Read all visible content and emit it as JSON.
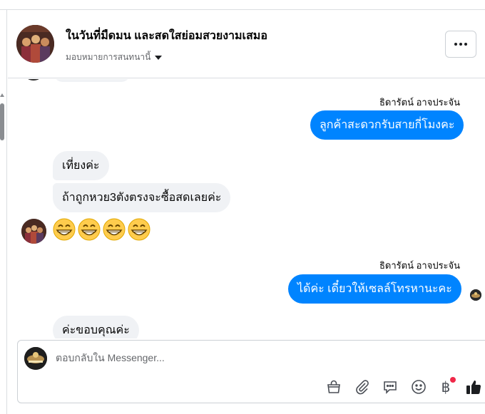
{
  "thread": {
    "title": "ในวันที่มืดมน และสดใสย่อมสวยงามเสมอ",
    "assign_label": "มอบหมายการสนทนานี้"
  },
  "messages": {
    "outgoing_1": {
      "sender": "ธิดารัตน์ อาจประจัน",
      "text": "ลูกค้าสะดวกรับสายกี่โมงคะ"
    },
    "incoming_1": "เที่ยงค่ะ",
    "incoming_2": "ถ้าถูกหวย3ตังตรงจะซื้อสดเลยค่ะ",
    "incoming_emoji": "😁😁😁😁",
    "outgoing_2": {
      "sender": "ธิดารัตน์ อาจประจัน",
      "text": "ได้ค่ะ เดี๋ยวให้เซลล์โทรหานะคะ"
    },
    "incoming_partial": "ค่ะขอบคุณค่ะ"
  },
  "composer": {
    "placeholder": "ตอบกลับใน Messenger...",
    "tools": [
      "shopping-bag-icon",
      "paperclip-icon",
      "saved-reply-icon",
      "smiley-icon",
      "baht-payment-icon",
      "thumbs-up-icon"
    ],
    "payment_symbol": "฿"
  },
  "colors": {
    "outgoing_bubble": "#0084ff",
    "incoming_bubble": "#f0f2f5",
    "notification_dot": "#f02849"
  }
}
